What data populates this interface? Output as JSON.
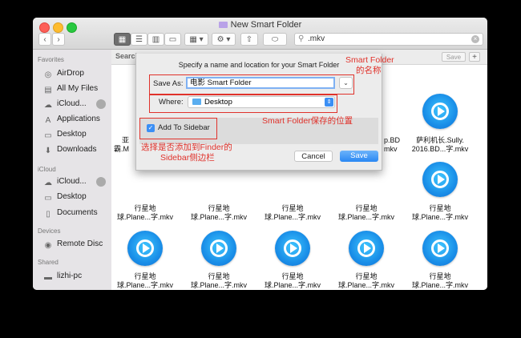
{
  "window": {
    "title": "New Smart Folder"
  },
  "toolbar": {
    "back": "‹",
    "forward": "›",
    "search_value": ".mkv"
  },
  "sidebar": {
    "favorites_header": "Favorites",
    "favorites": [
      {
        "label": "AirDrop",
        "icon": "airdrop-icon"
      },
      {
        "label": "All My Files",
        "icon": "all-files-icon"
      },
      {
        "label": "iCloud...",
        "icon": "cloud-icon"
      },
      {
        "label": "Applications",
        "icon": "applications-icon"
      },
      {
        "label": "Desktop",
        "icon": "desktop-icon"
      },
      {
        "label": "Downloads",
        "icon": "downloads-icon"
      }
    ],
    "icloud_header": "iCloud",
    "icloud": [
      {
        "label": "iCloud...",
        "icon": "cloud-icon"
      },
      {
        "label": "Desktop",
        "icon": "desktop-icon"
      },
      {
        "label": "Documents",
        "icon": "documents-icon"
      }
    ],
    "devices_header": "Devices",
    "devices": [
      {
        "label": "Remote Disc",
        "icon": "disc-icon"
      }
    ],
    "shared_header": "Shared",
    "shared": [
      {
        "label": "lizhi-pc",
        "icon": "computer-icon"
      }
    ]
  },
  "main": {
    "search_label": "Search",
    "save_btn": "Save",
    "add_btn": "+",
    "partial_files": [
      {
        "line1": "亚",
        "line2": "霸.M"
      },
      {
        "line1": "p.BD",
        "line2": "mkv"
      }
    ],
    "files": [
      {
        "line1": "萨利机长.Sully.",
        "line2": "2016.BD...字.mkv"
      },
      {
        "line1": "行星地",
        "line2": "球.Plane...字.mkv"
      },
      {
        "line1": "行星地",
        "line2": "球.Plane...字.mkv"
      },
      {
        "line1": "行星地",
        "line2": "球.Plane...字.mkv"
      },
      {
        "line1": "行星地",
        "line2": "球.Plane...字.mkv"
      },
      {
        "line1": "行星地",
        "line2": "球.Plane...字.mkv"
      },
      {
        "line1": "行星地",
        "line2": "球.Plane...字.mkv"
      },
      {
        "line1": "行星地",
        "line2": "球.Plane...字.mkv"
      },
      {
        "line1": "行星地",
        "line2": "球.Plane...字.mkv"
      },
      {
        "line1": "行星地",
        "line2": "球.Plane...字.mkv"
      },
      {
        "line1": "行星地",
        "line2": "球.Plane...字.mkv"
      }
    ]
  },
  "dialog": {
    "prompt": "Specify a name and location for your Smart Folder",
    "save_as_label": "Save As:",
    "save_as_value": "电影 Smart Folder",
    "where_label": "Where:",
    "where_value": "Desktop",
    "add_sidebar_label": "Add To Sidebar",
    "add_sidebar_checked": true,
    "cancel": "Cancel",
    "save": "Save"
  },
  "annotations": {
    "name_line1": "Smart Folder",
    "name_line2": "的名称",
    "location": "Smart Folder保存的位置",
    "sidebar_line1": "选择是否添加到Finder的",
    "sidebar_line2": "Sidebar侧边栏",
    "color": "#e0322b"
  }
}
